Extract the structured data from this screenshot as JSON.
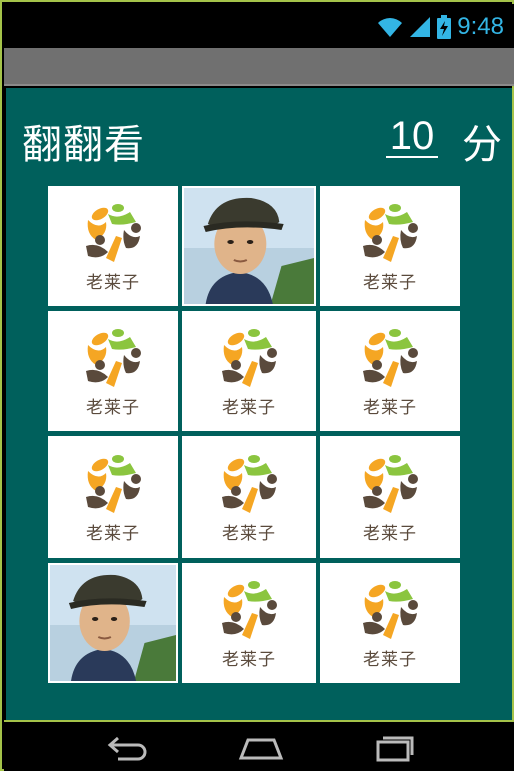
{
  "status_bar": {
    "time": "9:48",
    "icons": [
      "wifi-icon",
      "signal-icon",
      "battery-charging-icon"
    ],
    "color": "#33b5e5"
  },
  "app": {
    "title": "翻翻看",
    "score": "10",
    "score_unit": "分",
    "background": "#00605c"
  },
  "cards": [
    {
      "face": "logo",
      "label": "老莱子"
    },
    {
      "face": "photo"
    },
    {
      "face": "logo",
      "label": "老莱子"
    },
    {
      "face": "logo",
      "label": "老莱子"
    },
    {
      "face": "logo",
      "label": "老莱子"
    },
    {
      "face": "logo",
      "label": "老莱子"
    },
    {
      "face": "logo",
      "label": "老莱子"
    },
    {
      "face": "logo",
      "label": "老莱子"
    },
    {
      "face": "logo",
      "label": "老莱子"
    },
    {
      "face": "photo"
    },
    {
      "face": "logo",
      "label": "老莱子"
    },
    {
      "face": "logo",
      "label": "老莱子"
    }
  ],
  "nav_bar": {
    "buttons": [
      "back-icon",
      "home-icon",
      "recent-apps-icon"
    ]
  }
}
